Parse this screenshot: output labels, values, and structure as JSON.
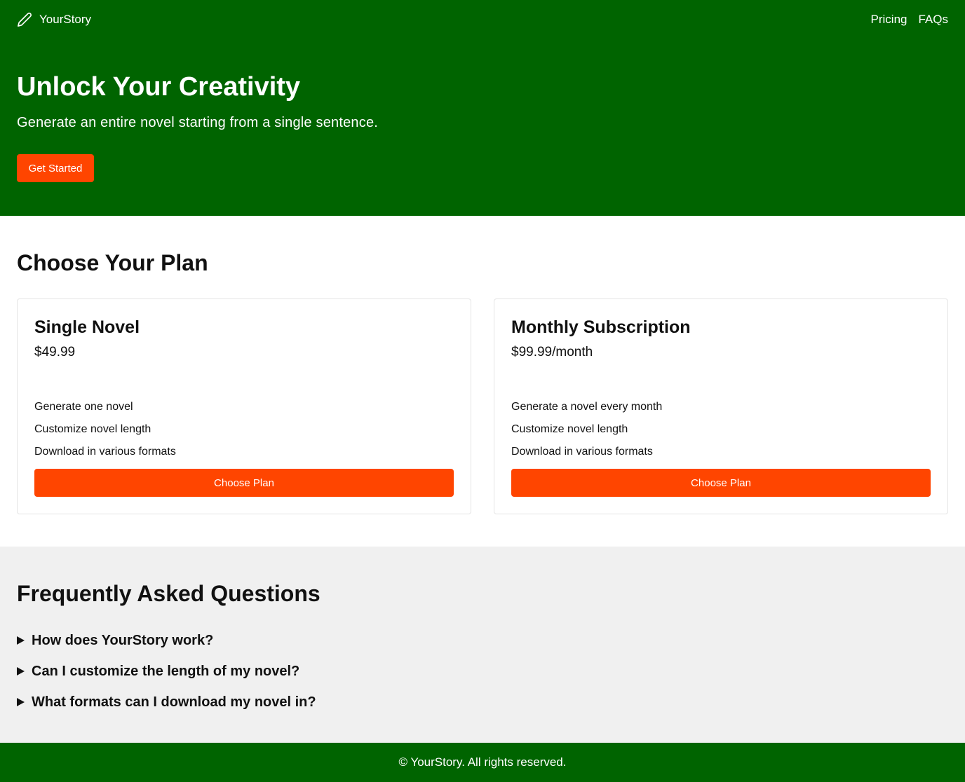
{
  "header": {
    "brand": "YourStory",
    "nav": [
      {
        "label": "Pricing"
      },
      {
        "label": "FAQs"
      }
    ]
  },
  "hero": {
    "title": "Unlock Your Creativity",
    "subtitle": "Generate an entire novel starting from a single sentence.",
    "cta_label": "Get Started"
  },
  "plans": {
    "heading": "Choose Your Plan",
    "items": [
      {
        "name": "Single Novel",
        "price": "$49.99",
        "features": [
          "Generate one novel",
          "Customize novel length",
          "Download in various formats"
        ],
        "button_label": "Choose Plan"
      },
      {
        "name": "Monthly Subscription",
        "price": "$99.99/month",
        "features": [
          "Generate a novel every month",
          "Customize novel length",
          "Download in various formats"
        ],
        "button_label": "Choose Plan"
      }
    ]
  },
  "faq": {
    "heading": "Frequently Asked Questions",
    "items": [
      {
        "question": "How does YourStory work?"
      },
      {
        "question": "Can I customize the length of my novel?"
      },
      {
        "question": "What formats can I download my novel in?"
      }
    ]
  },
  "footer": {
    "text": "© YourStory. All rights reserved."
  },
  "colors": {
    "primary_green": "#006400",
    "accent_orange": "#ff4500",
    "faq_background": "#f0f0f0"
  },
  "icons": {
    "brand": "pen-icon",
    "faq_toggle": "triangle-right-icon"
  }
}
